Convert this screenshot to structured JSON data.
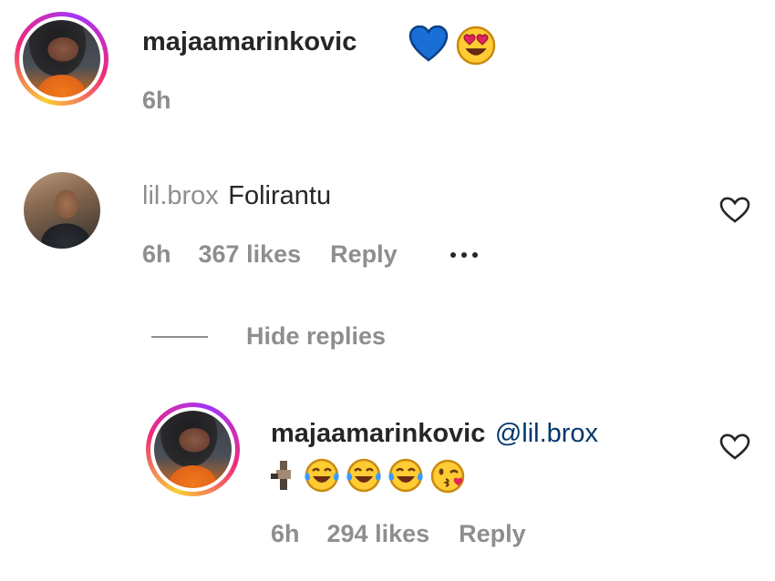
{
  "comments": [
    {
      "username": "majaamarinkovic",
      "emojis": [
        "blue-heart",
        "heart-eyes-face"
      ],
      "time": "6h"
    },
    {
      "username": "lil.brox",
      "text": "Folirantu",
      "time": "6h",
      "likes": "367 likes",
      "reply": "Reply",
      "hide_replies": "Hide replies",
      "replies": [
        {
          "username": "majaamarinkovic",
          "mention": "@lil.brox",
          "emojis": [
            "pixelated-emoji",
            "tears-of-joy",
            "tears-of-joy",
            "tears-of-joy",
            "face-blowing-kiss"
          ],
          "time": "6h",
          "likes": "294 likes",
          "reply": "Reply"
        }
      ]
    }
  ],
  "colors": {
    "primary_text": "#262626",
    "secondary_text": "#8e8e8e",
    "mention": "#00376b",
    "heart_blue": "#1a6fd6"
  }
}
